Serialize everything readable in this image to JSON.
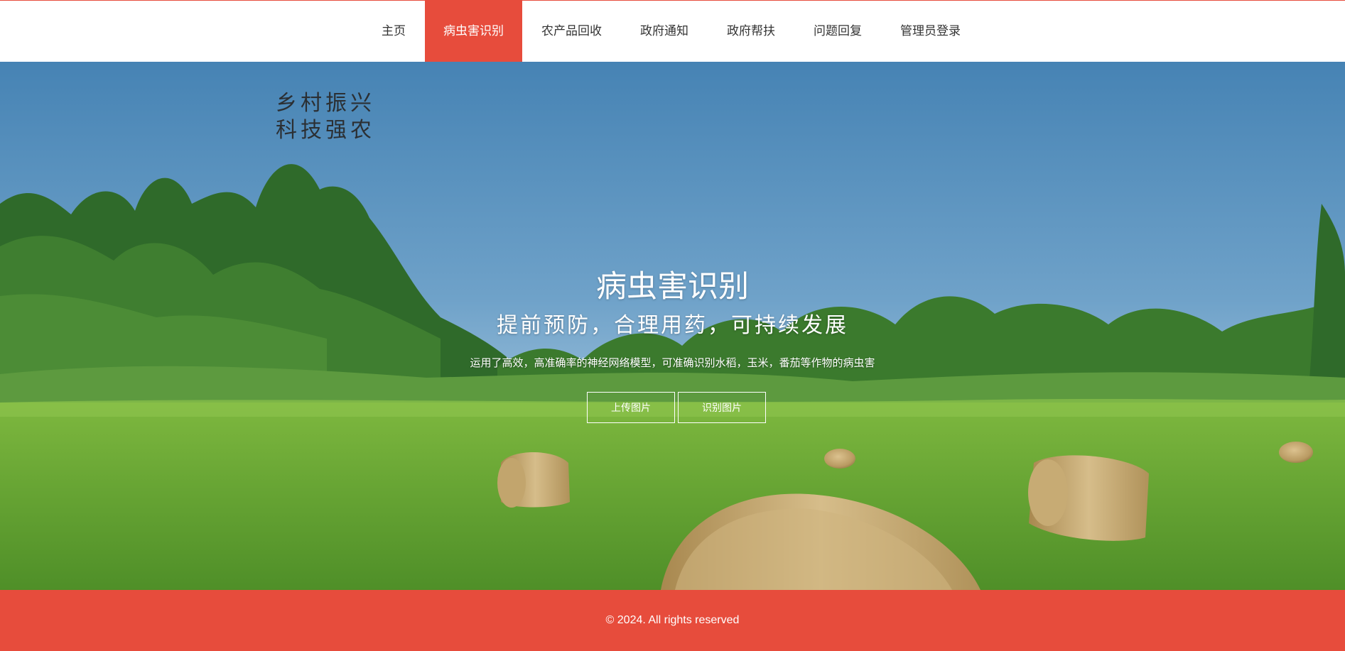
{
  "nav": {
    "items": [
      {
        "label": "主页",
        "active": false
      },
      {
        "label": "病虫害识别",
        "active": true
      },
      {
        "label": "农产品回收",
        "active": false
      },
      {
        "label": "政府通知",
        "active": false
      },
      {
        "label": "政府帮扶",
        "active": false
      },
      {
        "label": "问题回复",
        "active": false
      },
      {
        "label": "管理员登录",
        "active": false
      }
    ]
  },
  "hero": {
    "slogan_line1": "乡村振兴",
    "slogan_line2": "科技强农",
    "title": "病虫害识别",
    "subtitle": "提前预防，合理用药，可持续发展",
    "description": "运用了高效，高准确率的神经网络模型，可准确识别水稻，玉米，番茄等作物的病虫害",
    "upload_button": "上传图片",
    "identify_button": "识别图片"
  },
  "footer": {
    "copyright": "© 2024. All rights reserved"
  },
  "colors": {
    "accent": "#e74c3c",
    "sky_top": "#4a86b5",
    "grass": "#6fae3a"
  }
}
